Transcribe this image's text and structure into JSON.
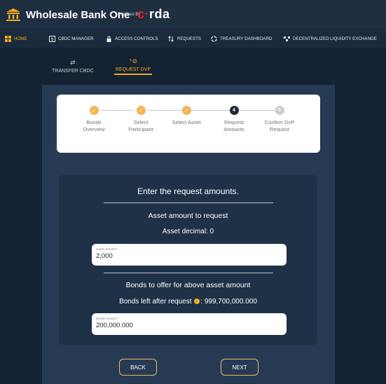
{
  "app": {
    "title": "Wholesale Bank One",
    "powered_by": "Powered By",
    "brand": "corda"
  },
  "nav": [
    {
      "label": "HOME",
      "icon": "home-icon",
      "active": true
    },
    {
      "label": "CBDC MANAGER",
      "icon": "cbdc-icon",
      "active": false
    },
    {
      "label": "ACCESS CONTROLS",
      "icon": "lock-icon",
      "active": false
    },
    {
      "label": "REQUESTS",
      "icon": "requests-icon",
      "active": false
    },
    {
      "label": "TREASURY DASHBOARD",
      "icon": "treasury-icon",
      "active": false
    },
    {
      "label": "DECENTRALIZED LIQUIDITY EXCHANGE",
      "icon": "exchange-icon",
      "active": false
    }
  ],
  "subtabs": [
    {
      "label": "TRANSFER CBDC",
      "icon": "transfer-icon",
      "active": false
    },
    {
      "label": "REQUEST DVP",
      "icon": "request-dvp-icon",
      "active": true
    }
  ],
  "stepper": {
    "steps": [
      {
        "label_1": "Bonds",
        "label_2": "Overview",
        "state": "done",
        "marker": "✓"
      },
      {
        "label_1": "Select",
        "label_2": "Participant",
        "state": "done",
        "marker": "✓"
      },
      {
        "label_1": "Select Asset",
        "label_2": "",
        "state": "done",
        "marker": "✓"
      },
      {
        "label_1": "Request",
        "label_2": "Amounts",
        "state": "current",
        "marker": "4"
      },
      {
        "label_1": "Confirm DvP",
        "label_2": "Request",
        "state": "todo",
        "marker": "5"
      }
    ]
  },
  "form": {
    "heading": "Enter the request amounts.",
    "asset_section_title": "Asset amount to request",
    "asset_decimal": "Asset decimal: 0",
    "asset_amount_label": "Asset Amount *",
    "asset_amount_value": "2,000",
    "bonds_section_title": "Bonds to offer for above asset amount",
    "bonds_left_text": "Bonds left after request",
    "bonds_left_value": ": 999,700,000.000",
    "bonds_amount_label": "Bonds Amount *",
    "bonds_amount_value": "200,000.000"
  },
  "buttons": {
    "back": "BACK",
    "next": "NEXT"
  },
  "colors": {
    "accent": "#f2a922",
    "background": "#142334",
    "panel": "#263b53"
  }
}
